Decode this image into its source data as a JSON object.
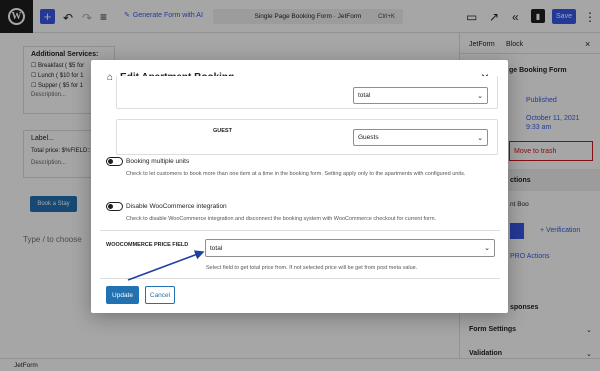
{
  "topbar": {
    "generate_ai_label": "Generate Form with AI",
    "doc_title": "Single Page Booking Form · JetForm",
    "shortcut": "Ctrl+K",
    "save_label": "Save"
  },
  "canvas": {
    "additional_services_title": "Additional Services:",
    "services": [
      "Breakfast ( $5 for",
      "Lunch ( $10 for 1",
      "Supper ( $5 for 1"
    ],
    "description1": "Description...",
    "label_text": "Label...",
    "total_price": "Total price: $%FIELD::",
    "description2": "Description...",
    "book_button": "Book a Stay",
    "type_prompt": "Type / to choose"
  },
  "sidebar": {
    "tab_jetform": "JetForm",
    "tab_block": "Block",
    "form_name": "ge Booking Form",
    "status": "Published",
    "date": "October 11, 2021",
    "time": "9:33 am",
    "trash": "Move to trash",
    "actions": "ctions",
    "action_item": "nt Boo",
    "verification": "+ Verification",
    "pro_actions": "PRO Actions",
    "responses": "sponses",
    "form_settings": "Form Settings",
    "validation": "Validation"
  },
  "statusbar": {
    "label": "JetForm"
  },
  "modal": {
    "title": "Edit Apartment Booking",
    "top_field_value": "total",
    "guest_label": "GUEST",
    "guest_value": "Guests",
    "booking_multiple_label": "Booking multiple units",
    "booking_multiple_help": "Check to let customers to book more than one item at a time in the booking form. Setting apply only to the apartments with configured units.",
    "disable_woo_label": "Disable WooCommerce integration",
    "disable_woo_help": "Check to disable WooCommerce integration and disconnect the booking system with WooCommerce checkout for current form.",
    "woo_price_label": "WOOCOMMERCE PRICE FIELD",
    "woo_price_value": "total",
    "woo_price_help": "Select field to get total price from. If not selected price will be get from post meta value.",
    "update_label": "Update",
    "cancel_label": "Cancel"
  },
  "colors": {
    "accent": "#3858e9",
    "wp_blue": "#2271b1",
    "arrow": "#1f3fa8",
    "trash_red": "#cc1818"
  }
}
